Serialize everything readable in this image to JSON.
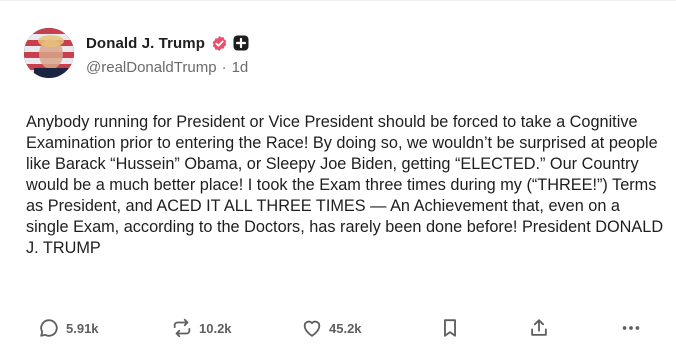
{
  "author": {
    "display_name": "Donald J. Trump",
    "handle": "@realDonaldTrump",
    "separator": "·",
    "time_ago": "1d",
    "verified_icon": "verified-badge-icon",
    "extra_icon": "plus-square-icon",
    "avatar_icon": "profile-photo-flag"
  },
  "post": {
    "text": "Anybody running for President or Vice President should be forced to take a Cognitive Examination prior to entering the Race! By doing so, we wouldn’t be surprised at people like Barack “Hussein” Obama, or Sleepy Joe Biden, getting “ELECTED.” Our Country would be a much better place! I took the Exam three times during my (“THREE!”) Terms as President, and ACED IT ALL THREE TIMES — An Achievement that, even on a single Exam, according to the Doctors, has rarely been done before! President DONALD J. TRUMP"
  },
  "actions": {
    "replies": "5.91k",
    "retruths": "10.2k",
    "likes": "45.2k",
    "icons": [
      "reply-bubble-icon",
      "retruth-icon",
      "heart-icon",
      "bookmark-icon",
      "share-icon",
      "more-icon"
    ]
  },
  "colors": {
    "verified": "#e8506d",
    "text": "#1e1e1e",
    "muted": "#6b6b6b",
    "icon": "#5f5f5f"
  }
}
